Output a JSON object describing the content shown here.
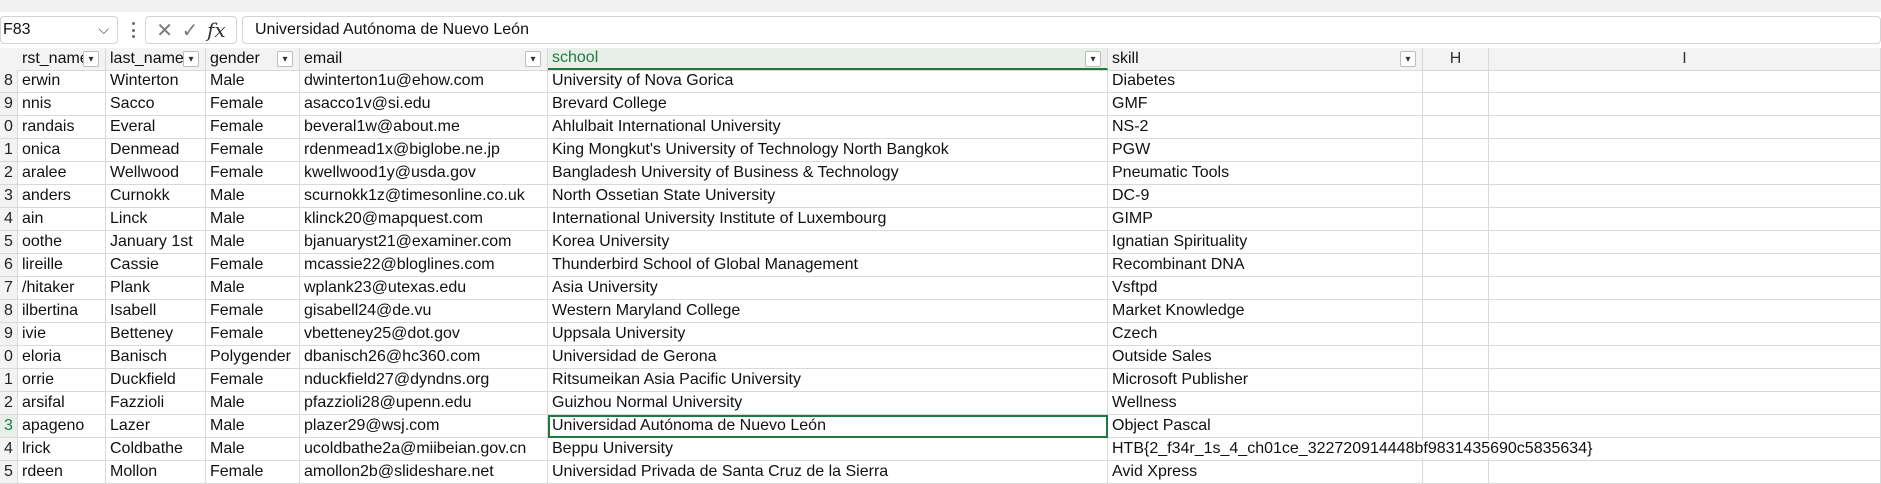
{
  "formula_bar": {
    "cell_ref": "F83",
    "namebox_chevron": "⌵",
    "cancel_icon": "✕",
    "enter_icon": "✓",
    "fx_label": "fx",
    "content": "Universidad Autónoma de Nuevo León"
  },
  "sheet": {
    "headers": [
      "rst_name",
      "last_name",
      "gender",
      "email",
      "school",
      "skill",
      "H",
      "I"
    ],
    "filter_glyph": "▾",
    "selected": {
      "row_index": 15,
      "col_key": "school"
    },
    "rows": [
      {
        "row": "8",
        "first": "erwin",
        "last": "Winterton",
        "gender": "Male",
        "email": "dwinterton1u@ehow.com",
        "school": "University of Nova Gorica",
        "skill": "Diabetes"
      },
      {
        "row": "9",
        "first": "nnis",
        "last": "Sacco",
        "gender": "Female",
        "email": "asacco1v@si.edu",
        "school": "Brevard College",
        "skill": "GMF"
      },
      {
        "row": "0",
        "first": "randais",
        "last": "Everal",
        "gender": "Female",
        "email": "beveral1w@about.me",
        "school": "Ahlulbait International University",
        "skill": "NS-2"
      },
      {
        "row": "1",
        "first": "onica",
        "last": "Denmead",
        "gender": "Female",
        "email": "rdenmead1x@biglobe.ne.jp",
        "school": "King Mongkut's University of Technology North Bangkok",
        "skill": "PGW"
      },
      {
        "row": "2",
        "first": "aralee",
        "last": "Wellwood",
        "gender": "Female",
        "email": "kwellwood1y@usda.gov",
        "school": "Bangladesh University of Business & Technology",
        "skill": "Pneumatic Tools"
      },
      {
        "row": "3",
        "first": "anders",
        "last": "Curnokk",
        "gender": "Male",
        "email": "scurnokk1z@timesonline.co.uk",
        "school": "North Ossetian State University",
        "skill": "DC-9"
      },
      {
        "row": "4",
        "first": "ain",
        "last": "Linck",
        "gender": "Male",
        "email": "klinck20@mapquest.com",
        "school": "International University Institute of Luxembourg",
        "skill": "GIMP"
      },
      {
        "row": "5",
        "first": "oothe",
        "last": "January 1st",
        "gender": "Male",
        "email": "bjanuaryst21@examiner.com",
        "school": "Korea University",
        "skill": "Ignatian Spirituality"
      },
      {
        "row": "6",
        "first": "lireille",
        "last": "Cassie",
        "gender": "Female",
        "email": "mcassie22@bloglines.com",
        "school": "Thunderbird School of Global Management",
        "skill": "Recombinant DNA"
      },
      {
        "row": "7",
        "first": "/hitaker",
        "last": "Plank",
        "gender": "Male",
        "email": "wplank23@utexas.edu",
        "school": "Asia University",
        "skill": "Vsftpd"
      },
      {
        "row": "8",
        "first": "ilbertina",
        "last": "Isabell",
        "gender": "Female",
        "email": "gisabell24@de.vu",
        "school": "Western Maryland College",
        "skill": "Market Knowledge"
      },
      {
        "row": "9",
        "first": "ivie",
        "last": "Betteney",
        "gender": "Female",
        "email": "vbetteney25@dot.gov",
        "school": "Uppsala University",
        "skill": "Czech"
      },
      {
        "row": "0",
        "first": "eloria",
        "last": "Banisch",
        "gender": "Polygender",
        "email": "dbanisch26@hc360.com",
        "school": "Universidad de Gerona",
        "skill": "Outside Sales"
      },
      {
        "row": "1",
        "first": "orrie",
        "last": "Duckfield",
        "gender": "Female",
        "email": "nduckfield27@dyndns.org",
        "school": "Ritsumeikan Asia Pacific University",
        "skill": "Microsoft Publisher"
      },
      {
        "row": "2",
        "first": "arsifal",
        "last": "Fazzioli",
        "gender": "Male",
        "email": "pfazzioli28@upenn.edu",
        "school": "Guizhou Normal University",
        "skill": "Wellness"
      },
      {
        "row": "3",
        "first": "apageno",
        "last": "Lazer",
        "gender": "Male",
        "email": "plazer29@wsj.com",
        "school": "Universidad Autónoma de Nuevo León",
        "skill": "Object Pascal"
      },
      {
        "row": "4",
        "first": "lrick",
        "last": "Coldbathe",
        "gender": "Male",
        "email": "ucoldbathe2a@miibeian.gov.cn",
        "school": "Beppu University",
        "skill": "HTB{2_f34r_1s_4_ch01ce_322720914448bf9831435690c5835634}"
      },
      {
        "row": "5",
        "first": "rdeen",
        "last": "Mollon",
        "gender": "Female",
        "email": "amollon2b@slideshare.net",
        "school": "Universidad Privada de Santa Cruz de la Sierra",
        "skill": "Avid Xpress"
      }
    ]
  }
}
